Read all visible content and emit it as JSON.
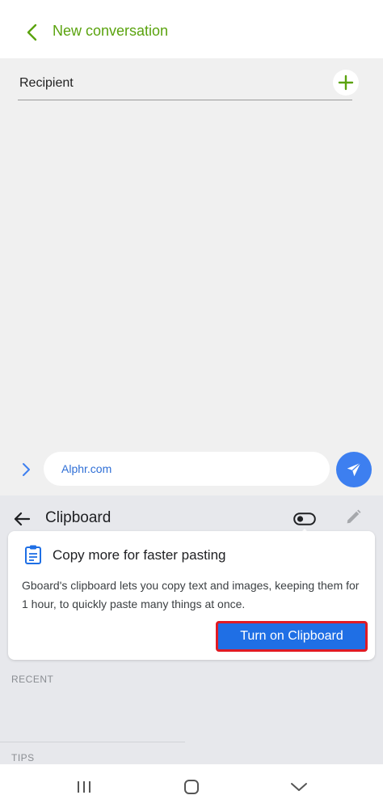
{
  "header": {
    "title": "New conversation",
    "back_icon": "chevron-left-icon",
    "accent_color": "#5aa30e"
  },
  "recipient": {
    "label": "Recipient",
    "add_icon": "plus-icon"
  },
  "compose": {
    "input_value": "Alphr.com",
    "expand_icon": "chevron-right-icon",
    "send_icon": "send-icon",
    "send_color": "#3d7ff0"
  },
  "keyboard": {
    "title": "Clipboard",
    "back_icon": "arrow-left-icon",
    "toggle_icon": "toggle-icon",
    "edit_icon": "pencil-icon",
    "card": {
      "icon": "clipboard-icon",
      "title": "Copy more for faster pasting",
      "body": "Gboard's clipboard lets you copy text and images, keeping them for 1 hour, to quickly paste many things at once.",
      "button_label": "Turn on Clipboard",
      "button_color": "#1f6fe5",
      "highlight_color": "#e01b24"
    },
    "recent_label": "RECENT",
    "tips_label": "TIPS"
  },
  "navbar": {
    "recents_icon": "recents-icon",
    "home_icon": "home-icon",
    "hide_keyboard_icon": "chevron-down-icon"
  }
}
